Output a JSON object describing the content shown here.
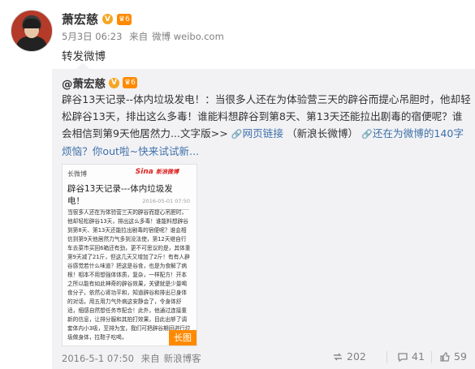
{
  "post": {
    "author": "萧宏慈",
    "v_badge": "V",
    "level_badge": "6",
    "timestamp": "5月3日 06:23",
    "source_prefix": "来自",
    "source": "微博 weibo.com",
    "repost_text": "转发微博"
  },
  "original": {
    "mention": "@萧宏慈",
    "v_badge": "V",
    "level_badge": "6",
    "text_part1": "辟谷13天记录--体内垃圾发电！：当很多人还在为体验营三天的辟谷而提心吊胆时，他却轻松辟谷13天，排出这么多毒！谁能料想辟谷到第8天、第13天还能拉出剧毒的宿便呢？谁会相信到第9天他居然力...文字版>>",
    "web_link": "网页链接",
    "text_part2": "（新浪长微博）",
    "promo_link": "还在为微博的140字烦恼？你out啦~快来试试新...",
    "thumbnail": {
      "header_left": "长微博",
      "brand": "Sina",
      "brand_sub": "新浪微博",
      "title": "辟谷13天记录---体内垃圾发电！",
      "date": "2016-05-01 07:50",
      "body": "当很多人还在为体验营三天的辟谷而提心吊胆时，他却轻松辟谷13天，排出这么多毒！谁能料想辟谷到第8天、第13天还能拉出剧毒的宿便呢？谁会相信到第9天他居然力气多到没法使，第12天继自行车去菜市买回6箱还有劲，更不可思议的是，其体重第9天减了21斤，但这几天又增加了2斤！有有人辟谷感觉若什么味道？把这是谷食，也是为食解了病根！相本不用想强体体质，复杂，一样配方！开本之所以能有如此神奇的辟谷效果，关键就是少量喝食分子，依然心肾功平和，知道辟谷和排出已身体的对话，用五用力气外病这安静会了，令身体舒适，细感自然想任务市配合！此外，他通过连接重新的信息，让排分服和其拍打效果，目此出够了调套体内小3吸，至排为宝，我们可把辟谷期间进行垃圾做身体，拉鞋子吃喝，",
      "badge": "长图"
    },
    "footer": {
      "timestamp": "2016-5-1 07:50",
      "source_prefix": "来自",
      "source": "新浪博客",
      "repost_count": "202",
      "comment_count": "41",
      "like_count": "59"
    }
  },
  "colors": {
    "link_orange": "#eb7350",
    "link_blue": "#3f70a8",
    "panel_bg": "#f2f2f5",
    "meta_gray": "#808080",
    "badge_orange": "#ff8a00"
  }
}
